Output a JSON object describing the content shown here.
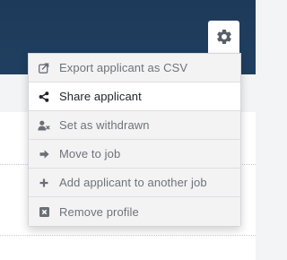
{
  "settings": {
    "icon": "gear-icon"
  },
  "menu": {
    "items": [
      {
        "label": "Export applicant as CSV",
        "icon": "export-icon",
        "active": false
      },
      {
        "label": "Share applicant",
        "icon": "share-icon",
        "active": true
      },
      {
        "label": "Set as withdrawn",
        "icon": "user-remove-icon",
        "active": false
      },
      {
        "label": "Move to job",
        "icon": "arrow-right-icon",
        "active": false
      },
      {
        "label": "Add applicant to another job",
        "icon": "plus-icon",
        "active": false
      },
      {
        "label": "Remove profile",
        "icon": "remove-box-icon",
        "active": false
      }
    ]
  },
  "colors": {
    "header": "#1e3a5a",
    "menu_text": "#6e737a",
    "menu_text_active": "#1e2329",
    "icon": "#6a6f76",
    "icon_active": "#1e2329"
  }
}
